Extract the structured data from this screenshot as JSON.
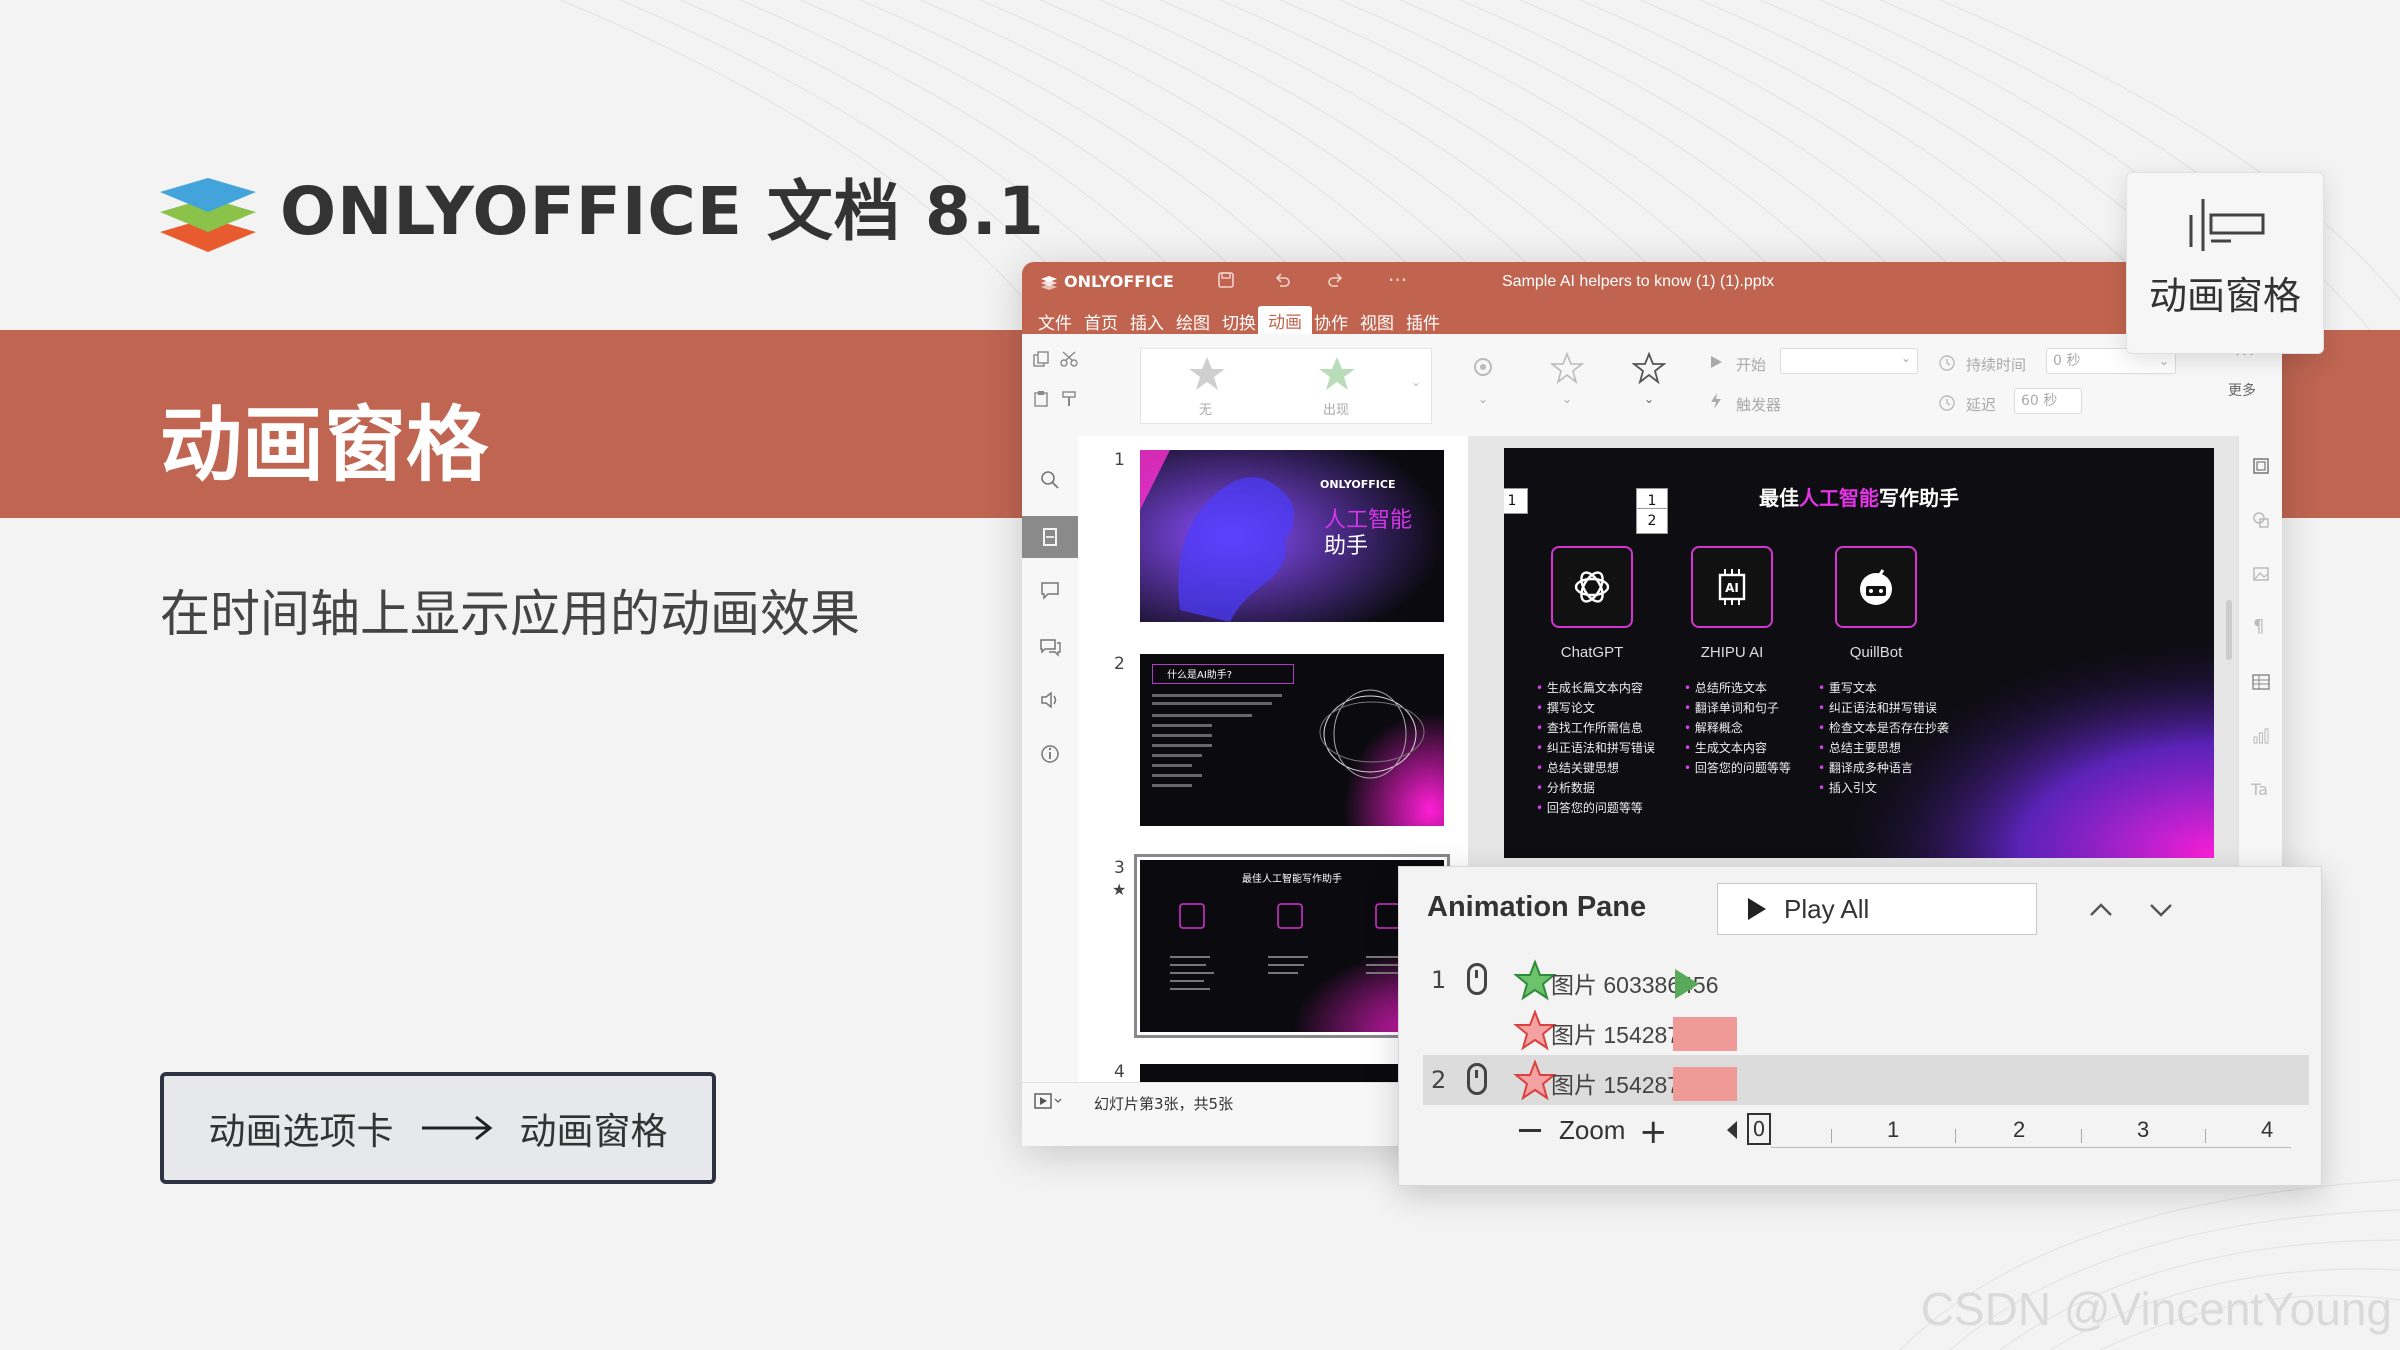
{
  "brand": {
    "title": "ONLYOFFICE 文档 8.1"
  },
  "banner": {
    "title": "动画窗格"
  },
  "subtitle": "在时间轴上显示应用的动画效果",
  "flow": {
    "from": "动画选项卡",
    "to": "动画窗格"
  },
  "float_button": {
    "label": "动画窗格",
    "icon": "animation-pane-icon"
  },
  "watermark": "CSDN @VincentYoung",
  "editor": {
    "logo": "ONLYOFFICE",
    "filename": "Sample AI helpers to know (1) (1).pptx",
    "titlebar_icons": [
      "save-icon",
      "undo-icon",
      "redo-icon",
      "more-icon"
    ],
    "menu": [
      "文件",
      "首页",
      "插入",
      "绘图",
      "切换",
      "动画",
      "协作",
      "视图",
      "插件"
    ],
    "active_menu": "动画",
    "toolbar": {
      "effect_none": "无",
      "effect_appear": "出现",
      "start_label": "开始",
      "duration_label": "持续时间",
      "duration_value": "0 秒",
      "trigger_label": "触发器",
      "delay_label": "延迟",
      "delay_value": "60 秒",
      "more_label": "更多"
    },
    "thumbnails": [
      {
        "num": "1",
        "brand": "ONLYOFFICE",
        "line1": "人工智能",
        "line2": "助手"
      },
      {
        "num": "2",
        "heading": "什么是AI助手?"
      },
      {
        "num": "3",
        "heading": "最佳人工智能写作助手"
      },
      {
        "num": "4"
      }
    ],
    "status": "幻灯片第3张，共5张",
    "slide": {
      "title_pre": "最佳",
      "title_accent": "人工智能",
      "title_post": "写作助手",
      "badges": [
        "1",
        "1",
        "2"
      ],
      "columns": [
        {
          "name": "ChatGPT",
          "icon": "chatgpt-icon",
          "items": [
            "生成长篇文本内容",
            "撰写论文",
            "查找工作所需信息",
            "纠正语法和拼写错误",
            "总结关键思想",
            "分析数据",
            "回答您的问题等等"
          ]
        },
        {
          "name": "ZHIPU AI",
          "icon": "ai-chip-icon",
          "items": [
            "总结所选文本",
            "翻译单词和句子",
            "解释概念",
            "生成文本内容",
            "回答您的问题等等"
          ]
        },
        {
          "name": "QuillBot",
          "icon": "quillbot-icon",
          "items": [
            "重写文本",
            "纠正语法和拼写错误",
            "检查文本是否存在抄袭",
            "总结主要思想",
            "翻译成多种语言",
            "插入引文"
          ]
        }
      ]
    }
  },
  "animation_pane": {
    "title": "Animation Pane",
    "play_all": "Play All",
    "rows": [
      {
        "num": "1",
        "effect": "entrance",
        "star_color": "#3aa14a",
        "name": "图片 603386456",
        "bar": "play",
        "bar_color": "#5aa85a"
      },
      {
        "num": "",
        "effect": "emphasis",
        "star_color": "#e05555",
        "name": "图片 154287349",
        "bar": "block",
        "bar_color": "#f09a98"
      },
      {
        "num": "2",
        "effect": "emphasis",
        "star_color": "#e05555",
        "name": "图片 154287349",
        "bar": "block",
        "bar_color": "#f09a98"
      }
    ],
    "zoom_label": "Zoom",
    "timeline": [
      "0",
      "1",
      "2",
      "3",
      "4"
    ]
  },
  "colors": {
    "accent": "#bf6552",
    "titlebar": "#c0644f",
    "dark_frame": "#2d3342"
  }
}
